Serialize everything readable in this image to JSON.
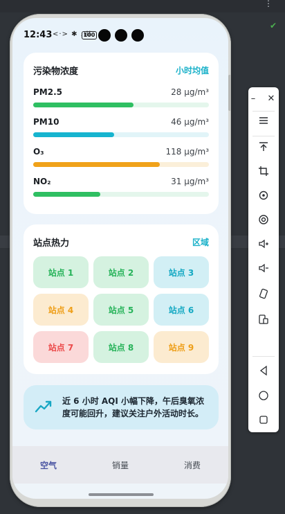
{
  "status_bar": {
    "time": "12:43",
    "icons": "<·> ✱ .ıll",
    "battery": "100"
  },
  "pollutant_card": {
    "title": "污染物浓度",
    "link_label": "小时均值",
    "items": [
      {
        "name": "PM2.5",
        "value": "28 μg/m³",
        "level": 0.57,
        "fill_color": "#2fbf62",
        "track_color": "#e4f6ec"
      },
      {
        "name": "PM10",
        "value": "46 μg/m³",
        "level": 0.46,
        "fill_color": "#17b4cf",
        "track_color": "#e1f4f8"
      },
      {
        "name": "O₃",
        "value": "118 μg/m³",
        "level": 0.72,
        "fill_color": "#f0a21a",
        "track_color": "#fbefd9"
      },
      {
        "name": "NO₂",
        "value": "31 μg/m³",
        "level": 0.38,
        "fill_color": "#2fbf62",
        "track_color": "#e4f6ec"
      }
    ]
  },
  "station_card": {
    "title": "站点热力",
    "link_label": "区域",
    "stations": [
      {
        "label": "站点 1",
        "text_color": "#27b35a",
        "bg_color": "#d5f2e0"
      },
      {
        "label": "站点 2",
        "text_color": "#27b35a",
        "bg_color": "#d5f2e0"
      },
      {
        "label": "站点 3",
        "text_color": "#15a9c3",
        "bg_color": "#d2eff5"
      },
      {
        "label": "站点 4",
        "text_color": "#ee9f19",
        "bg_color": "#fcebd0"
      },
      {
        "label": "站点 5",
        "text_color": "#27b35a",
        "bg_color": "#d5f2e0"
      },
      {
        "label": "站点 6",
        "text_color": "#15a9c3",
        "bg_color": "#d2eff5"
      },
      {
        "label": "站点 7",
        "text_color": "#ec4b4b",
        "bg_color": "#fbd9d9"
      },
      {
        "label": "站点 8",
        "text_color": "#27b35a",
        "bg_color": "#d5f2e0"
      },
      {
        "label": "站点 9",
        "text_color": "#ee9f19",
        "bg_color": "#fcebd0"
      }
    ]
  },
  "insight": {
    "icon": "trend-icon",
    "text": "近 6 小时 AQI 小幅下降，午后臭氧浓度可能回升，建议关注户外活动时长。"
  },
  "bottom_nav": {
    "tabs": [
      {
        "label": "空气",
        "active": true
      },
      {
        "label": "销量",
        "active": false
      },
      {
        "label": "消费",
        "active": false
      }
    ]
  },
  "colors": {
    "accent": "#1ab1c9",
    "nav_active": "#4a55a2"
  }
}
